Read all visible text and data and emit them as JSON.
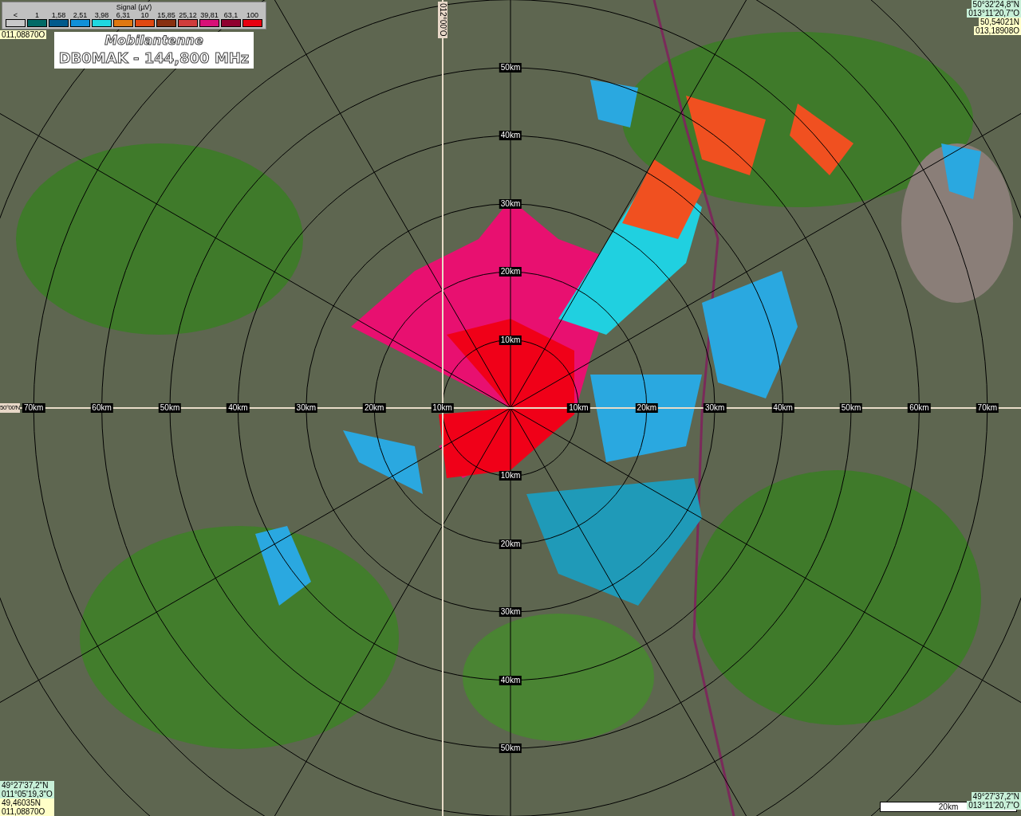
{
  "legend": {
    "title": "Signal (µV)",
    "items": [
      {
        "label": "<",
        "color": "#c8c8c8"
      },
      {
        "label": "1",
        "color": "#006a66"
      },
      {
        "label": "1,58",
        "color": "#005a8c"
      },
      {
        "label": "2,51",
        "color": "#1090d8"
      },
      {
        "label": "3,98",
        "color": "#20d8e0"
      },
      {
        "label": "6,31",
        "color": "#e07810"
      },
      {
        "label": "10",
        "color": "#e04810"
      },
      {
        "label": "15,85",
        "color": "#883010"
      },
      {
        "label": "25,12",
        "color": "#d03c3c"
      },
      {
        "label": "39,81",
        "color": "#d81078"
      },
      {
        "label": "63,1",
        "color": "#900030"
      },
      {
        "label": "100",
        "color": "#e80010"
      }
    ]
  },
  "title_box": {
    "lines": [
      "Mobilantenne",
      "DB0MAK - 144,800 MHz"
    ]
  },
  "corners": {
    "top_left": [
      "011,08870O"
    ],
    "top_right": [
      "50°32'24,8\"N",
      "013°11'20,7\"O",
      "50,54021N",
      "013,18908O"
    ],
    "bottom_left": [
      "49°27'37,2\"N",
      "011°05'19,3\"O",
      "49,46035N",
      "011,08870O"
    ],
    "bottom_right": [
      "49°27'37,2\"N",
      "013°11'20,7\"O"
    ]
  },
  "grid": {
    "latitude_label": "50°00'N",
    "longitude_label": "012°00'O"
  },
  "range_labels": {
    "west": [
      "70km",
      "60km",
      "50km",
      "40km",
      "30km",
      "20km",
      "10km"
    ],
    "east": [
      "10km",
      "20km",
      "30km",
      "40km",
      "50km",
      "60km",
      "70km"
    ],
    "north": [
      "50km",
      "40km",
      "30km",
      "20km",
      "10km"
    ],
    "south": [
      "10km",
      "20km",
      "30km",
      "40km",
      "50km"
    ]
  },
  "scale_bar": {
    "label": "20km"
  }
}
